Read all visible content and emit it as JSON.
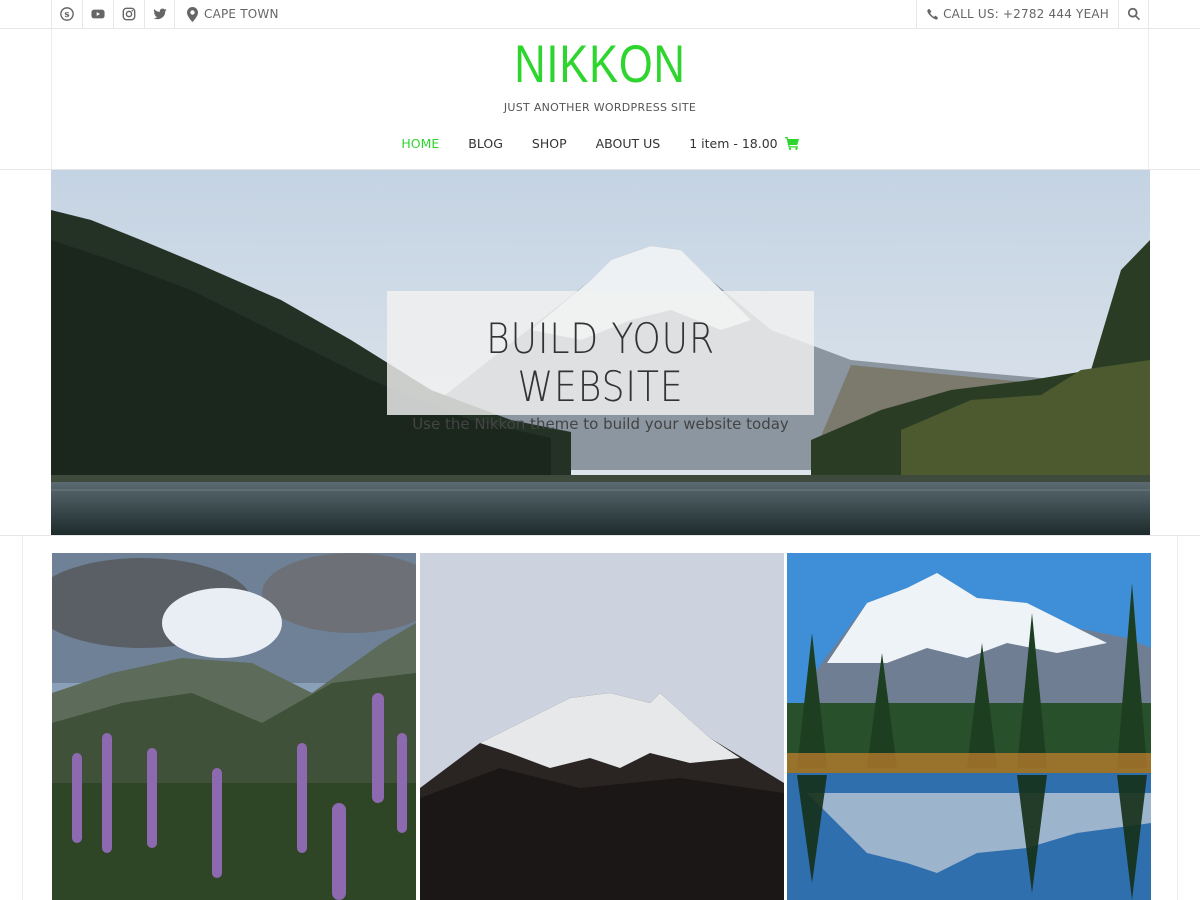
{
  "topbar": {
    "social_icons": [
      "skype-icon",
      "youtube-icon",
      "instagram-icon",
      "twitter-icon"
    ],
    "location": "CAPE TOWN",
    "phone": "CALL US: +2782 444 YEAH"
  },
  "header": {
    "site_title": "NIKKON",
    "tagline": "JUST ANOTHER WORDPRESS SITE"
  },
  "nav": {
    "items": [
      {
        "label": "HOME",
        "active": true
      },
      {
        "label": "BLOG"
      },
      {
        "label": "SHOP"
      },
      {
        "label": "ABOUT US"
      }
    ],
    "cart_label": "1 item - 18.00"
  },
  "hero": {
    "title": "BUILD YOUR WEBSITE",
    "subtitle": "Use the Nikkon theme to build your website today"
  },
  "colors": {
    "accent": "#2fd52f",
    "text": "#333333",
    "border": "#e6e6e6"
  }
}
